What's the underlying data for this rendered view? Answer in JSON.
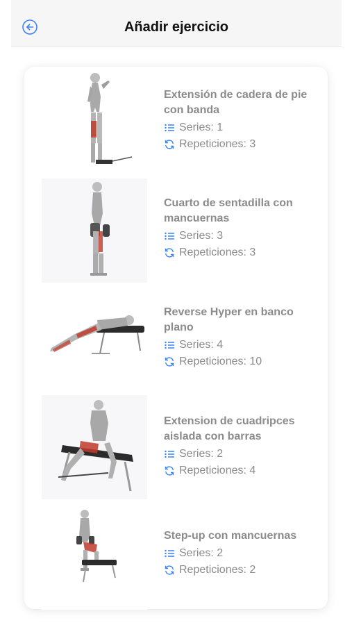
{
  "header": {
    "title": "Añadir ejercicio",
    "back_icon": "arrow-left-circle-icon"
  },
  "labels": {
    "series": "Series:",
    "reps": "Repeticiones:"
  },
  "icons": {
    "series": "list-icon",
    "reps": "refresh-icon"
  },
  "colors": {
    "accent": "#3b82f6",
    "muscle": "#c0392b",
    "text_muted": "#8b8b8b"
  },
  "exercises": [
    {
      "name": "Extensión de cadera de pie con banda",
      "series": "1",
      "reps": "3"
    },
    {
      "name": "Cuarto de sentadilla con mancuernas",
      "series": "3",
      "reps": "3"
    },
    {
      "name": "Reverse Hyper en banco plano",
      "series": "4",
      "reps": "10"
    },
    {
      "name": "Extension de cuadripces aislada con barras",
      "series": "2",
      "reps": "4"
    },
    {
      "name": "Step-up con mancuernas",
      "series": "2",
      "reps": "2"
    }
  ]
}
